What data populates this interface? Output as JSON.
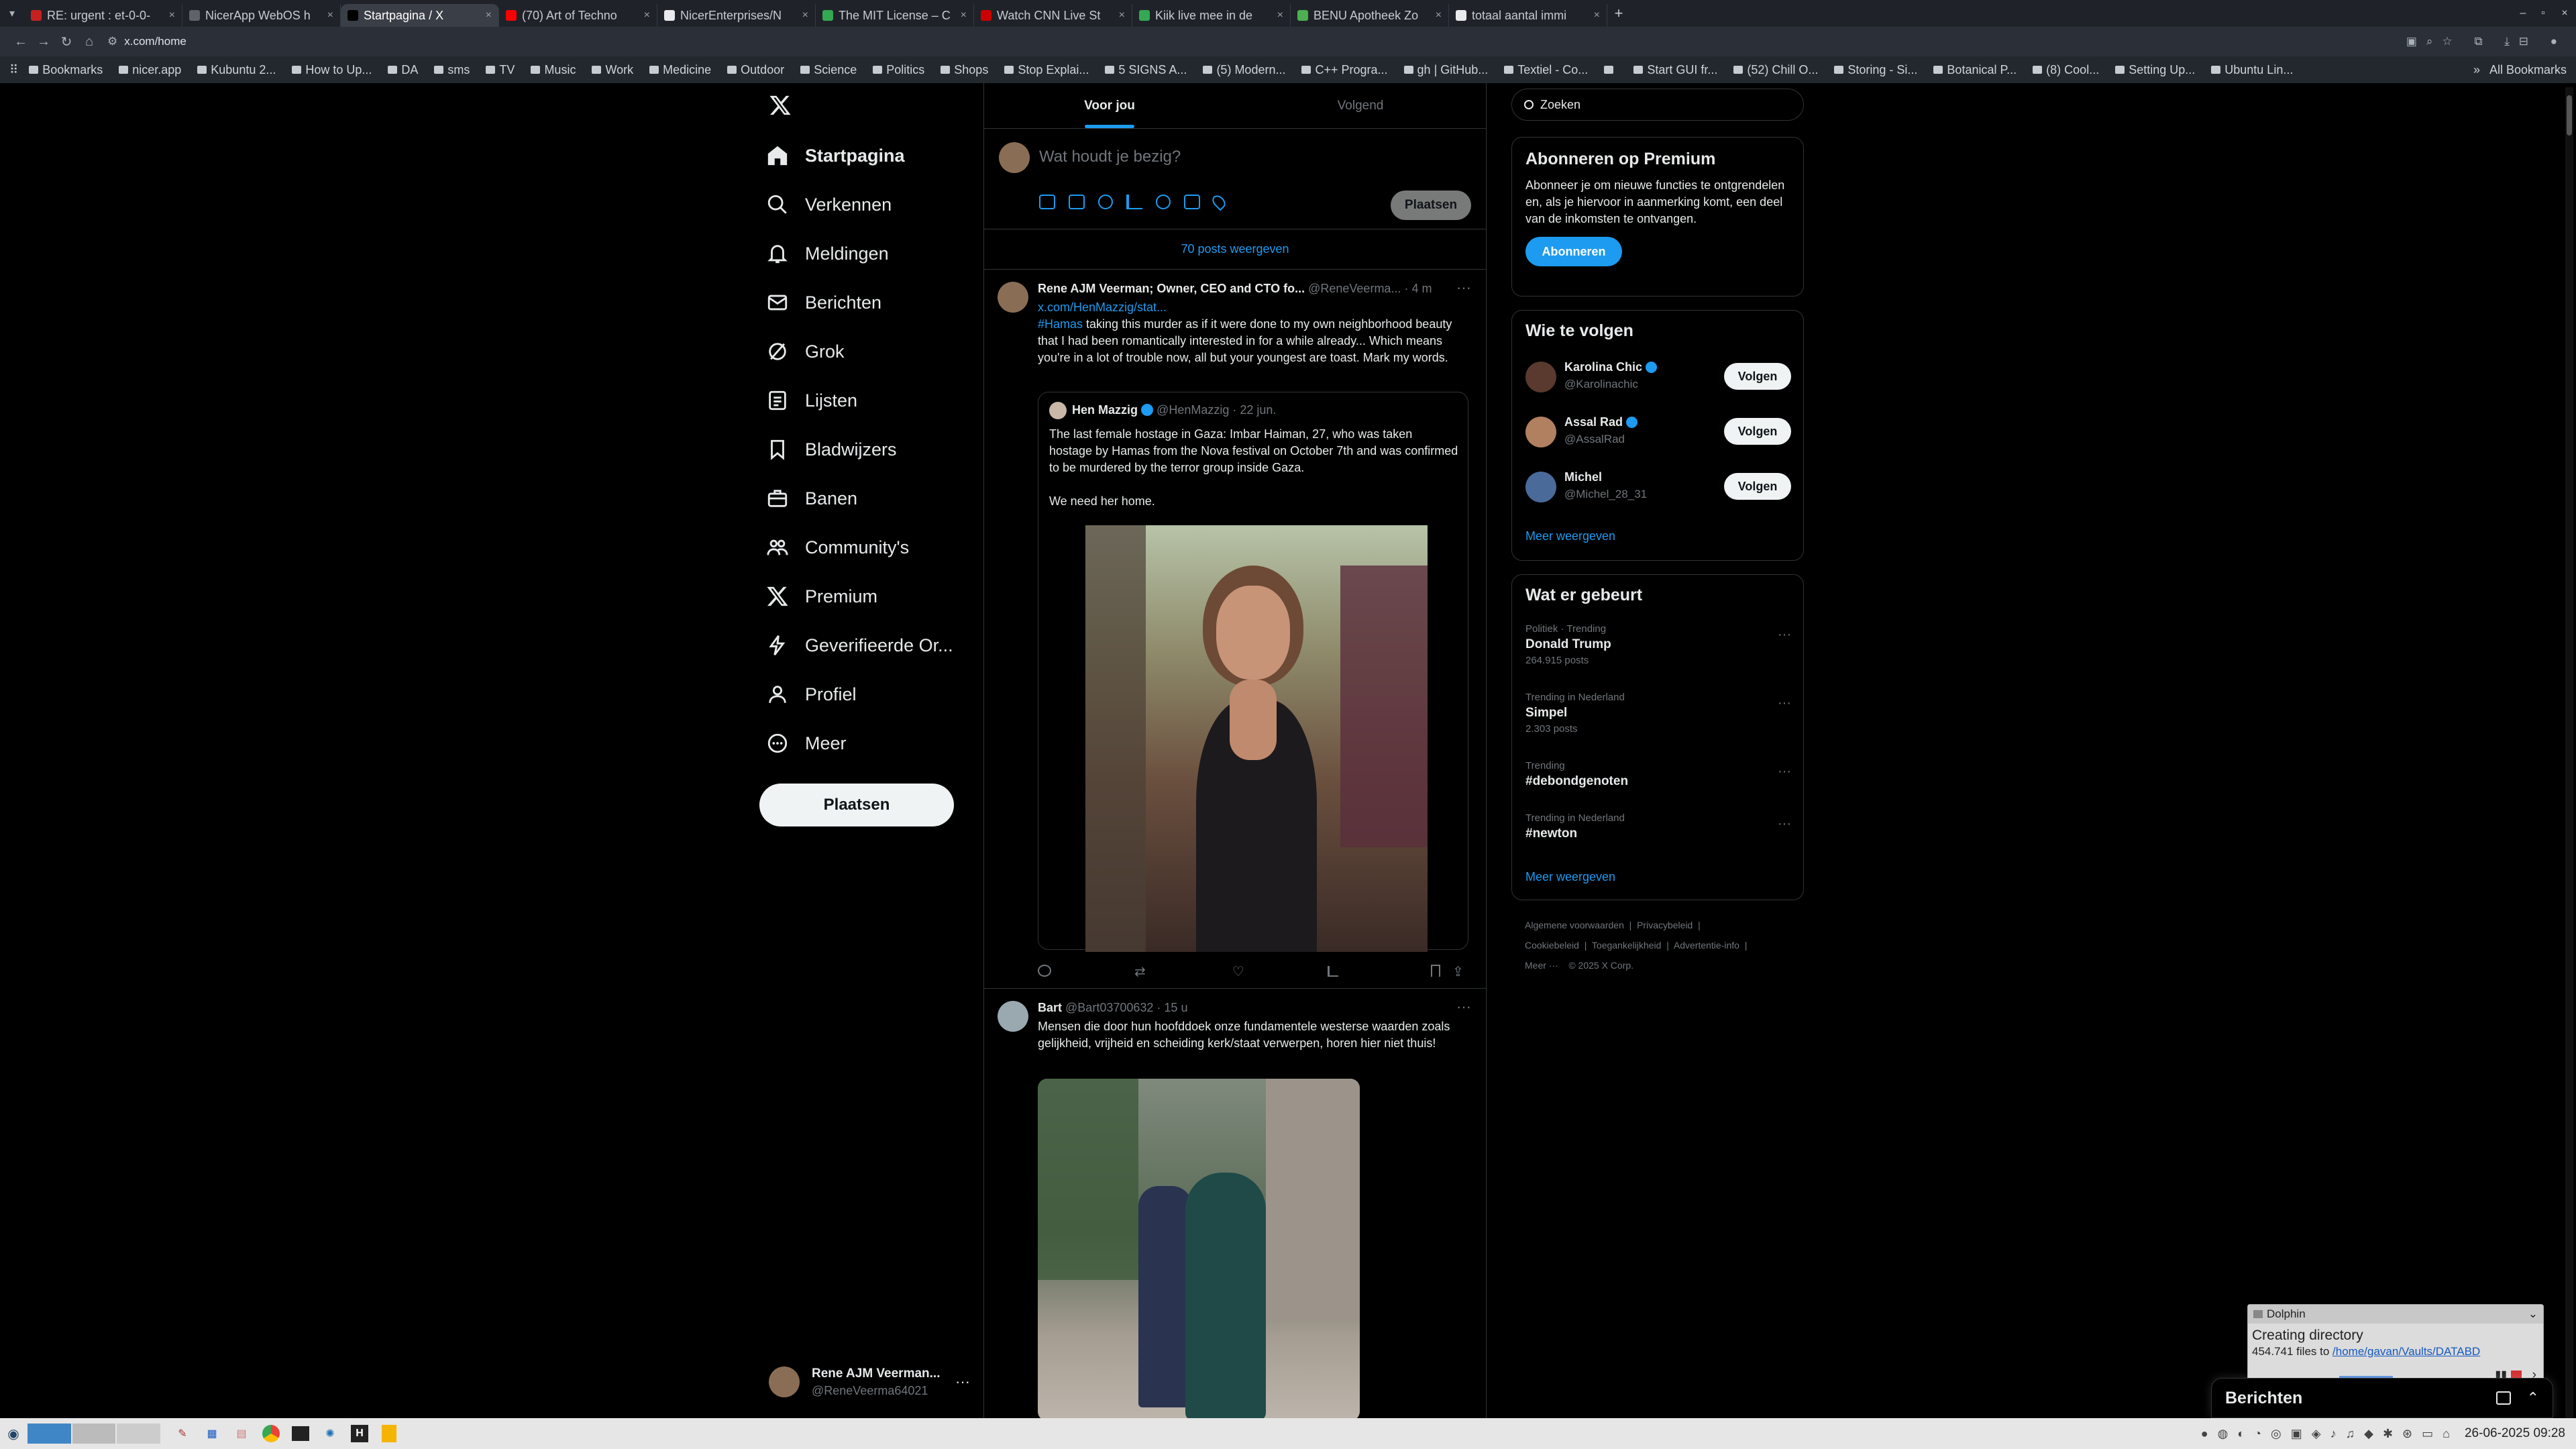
{
  "browser": {
    "tabs": [
      {
        "title": "RE: urgent : et-0-0-",
        "color": "#c5221f"
      },
      {
        "title": "NicerApp WebOS h",
        "color": "#5f6368"
      },
      {
        "title": "Startpagina / X",
        "color": "#000000",
        "active": true
      },
      {
        "title": "(70) Art of Techno",
        "color": "#ff0000"
      },
      {
        "title": "NicerEnterprises/N",
        "color": "#e8eaed"
      },
      {
        "title": "The MIT License – C",
        "color": "#34a853"
      },
      {
        "title": "Watch CNN Live St",
        "color": "#cc0000"
      },
      {
        "title": "Kiik live mee in de",
        "color": "#34a853"
      },
      {
        "title": "BENU Apotheek Zo",
        "color": "#4caf50"
      },
      {
        "title": "totaal aantal immi",
        "color": "#e8eaed"
      }
    ],
    "url": "x.com/home",
    "bookmarks": [
      "Bookmarks",
      "nicer.app",
      "Kubuntu 2...",
      "How to Up...",
      "DA",
      "sms",
      "TV",
      "Music",
      "Work",
      "Medicine",
      "Outdoor",
      "Science",
      "Politics",
      "Shops",
      "Stop Explai...",
      "5 SIGNS A...",
      "(5) Modern...",
      "C++ Progra...",
      "gh | GitHub...",
      "Textiel - Co...",
      "",
      "Start GUI fr...",
      "(52) Chill O...",
      "Storing - Si...",
      "Botanical P...",
      "(8) Cool...",
      "Setting Up...",
      "Ubuntu Lin..."
    ],
    "all_bookmarks": "All Bookmarks"
  },
  "nav": {
    "items": [
      {
        "label": "Startpagina",
        "icon": "home-icon"
      },
      {
        "label": "Verkennen",
        "icon": "search-icon"
      },
      {
        "label": "Meldingen",
        "icon": "bell-icon"
      },
      {
        "label": "Berichten",
        "icon": "mail-icon"
      },
      {
        "label": "Grok",
        "icon": "grok-icon"
      },
      {
        "label": "Lijsten",
        "icon": "list-icon"
      },
      {
        "label": "Bladwijzers",
        "icon": "bookmark-icon"
      },
      {
        "label": "Banen",
        "icon": "briefcase-icon"
      },
      {
        "label": "Community's",
        "icon": "people-icon"
      },
      {
        "label": "Premium",
        "icon": "x-logo-icon"
      },
      {
        "label": "Geverifieerde Or...",
        "icon": "lightning-icon"
      },
      {
        "label": "Profiel",
        "icon": "person-icon"
      },
      {
        "label": "Meer",
        "icon": "more-circle-icon"
      }
    ],
    "post_button": "Plaatsen",
    "account": {
      "name": "Rene AJM Veerman...",
      "handle": "@ReneVeerma64021"
    }
  },
  "feed": {
    "tabs": [
      "Voor jou",
      "Volgend"
    ],
    "compose_placeholder": "Wat houdt je bezig?",
    "compose_button": "Plaatsen",
    "show_posts": "70 posts weergeven",
    "post1": {
      "author": "Rene AJM Veerman; Owner, CEO and CTO fo...",
      "handle": "@ReneVeerma...",
      "time": "· 4 m",
      "link": "x.com/HenMazzig/stat...",
      "hashtag": "#Hamas",
      "text": " taking this murder as if it were done to my own neighborhood beauty that I had been romantically interested in for a while already... Which means you're in a lot of trouble now, all but your youngest are toast. Mark my words.",
      "quote": {
        "author": "Hen Mazzig",
        "handle": "@HenMazzig",
        "time": "· 22 jun.",
        "text1": "The last female hostage in Gaza: Imbar Haiman, 27, who was taken hostage by Hamas from the Nova festival on October 7th and was confirmed to be murdered by the terror group inside Gaza.",
        "text2": "We need her home."
      }
    },
    "post2": {
      "author": "Bart",
      "handle": "@Bart03700632",
      "time": "· 15 u",
      "text": "Mensen die door hun hoofddoek onze fundamentele westerse waarden zoals gelijkheid, vrijheid en scheiding kerk/staat verwerpen, horen hier niet thuis!"
    }
  },
  "right": {
    "search_placeholder": "Zoeken",
    "premium": {
      "title": "Abonneren op Premium",
      "text": "Abonneer je om nieuwe functies te ontgrendelen en, als je hiervoor in aanmerking komt, een deel van de inkomsten te ontvangen.",
      "button": "Abonneren"
    },
    "follow": {
      "title": "Wie te volgen",
      "button": "Volgen",
      "users": [
        {
          "name": "Karolina Chic",
          "handle": "@Karolinachic"
        },
        {
          "name": "Assal Rad",
          "handle": "@AssalRad"
        },
        {
          "name": "Michel",
          "handle": "@Michel_28_31"
        }
      ],
      "more": "Meer weergeven"
    },
    "trends": {
      "title": "Wat er gebeurt",
      "items": [
        {
          "context": "Politiek · Trending",
          "name": "Donald Trump",
          "count": "264.915 posts"
        },
        {
          "context": "Trending in Nederland",
          "name": "Simpel",
          "count": "2.303 posts"
        },
        {
          "context": "Trending",
          "name": "#debondgenoten",
          "count": ""
        },
        {
          "context": "Trending in Nederland",
          "name": "#newton",
          "count": ""
        }
      ],
      "more": "Meer weergeven"
    },
    "footer": {
      "line1": [
        "Algemene voorwaarden",
        "Privacybeleid"
      ],
      "line2": [
        "Cookiebeleid",
        "Toegankelijkheid",
        "Advertentie-info"
      ],
      "more": "Meer ···",
      "copyright": "© 2025 X Corp."
    }
  },
  "messages_drawer": {
    "title": "Berichten"
  },
  "dolphin": {
    "app": "Dolphin",
    "title": "Creating directory",
    "count": "454.741 files to",
    "path": "/home/gavan/Vaults/DATABD"
  },
  "system": {
    "datetime": "26-06-2025 09:28"
  }
}
